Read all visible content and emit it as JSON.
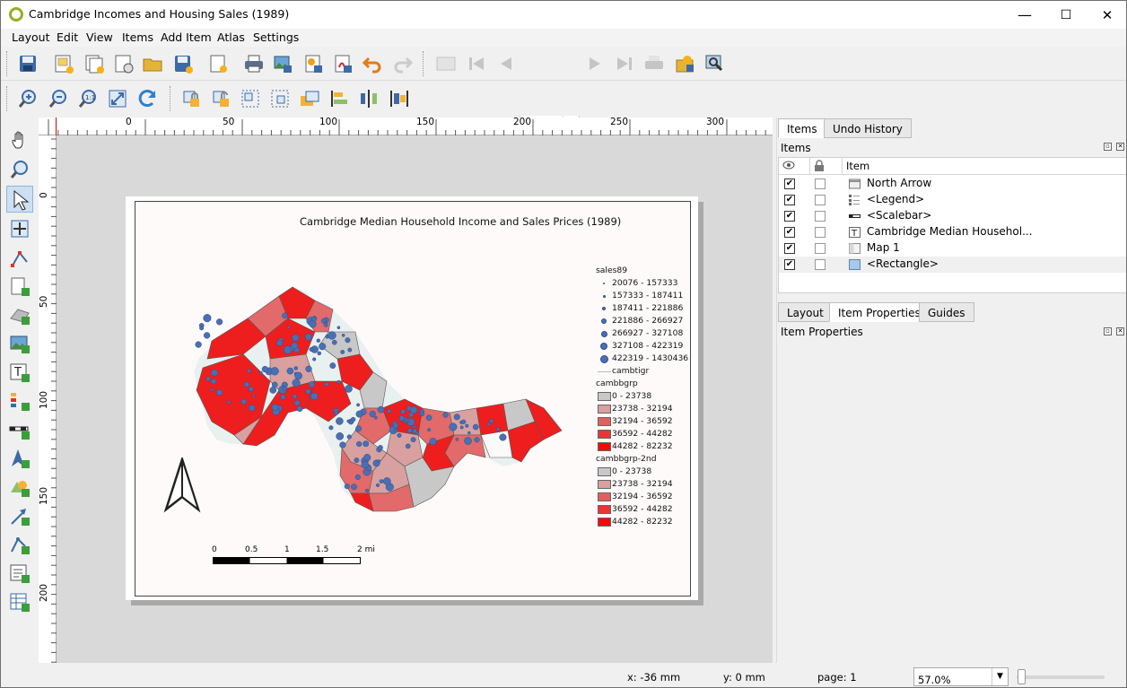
{
  "window": {
    "title": "Cambridge Incomes and Housing Sales (1989)",
    "controls": {
      "minimize": "—",
      "maximize": "☐",
      "close": "✕"
    }
  },
  "menu": [
    "Layout",
    "Edit",
    "View",
    "Items",
    "Add Item",
    "Atlas",
    "Settings"
  ],
  "toolbar": {
    "page_number": "1"
  },
  "ruler": {
    "top": [
      "0",
      "50",
      "100",
      "150",
      "200",
      "250",
      "300"
    ],
    "left": [
      "0",
      "50",
      "100",
      "150",
      "200"
    ]
  },
  "layout": {
    "map_title": "Cambridge Median Household Income and Sales Prices (1989)",
    "legend": {
      "groups": [
        {
          "title": "sales89",
          "kind": "points",
          "items": [
            "20076 - 157333",
            "157333 - 187411",
            "187411 - 221886",
            "221886 - 266927",
            "266927 - 327108",
            "327108 - 422319",
            "422319 - 1430436"
          ]
        },
        {
          "title": "",
          "kind": "line",
          "items": [
            "cambtigr"
          ]
        },
        {
          "title": "cambbgrp",
          "kind": "fill",
          "items": [
            "0 - 23738",
            "23738 - 32194",
            "32194 - 36592",
            "36592 - 44282",
            "44282 - 82232"
          ]
        },
        {
          "title": "cambbgrp-2nd",
          "kind": "fill",
          "items": [
            "0 - 23738",
            "23738 - 32194",
            "32194 - 36592",
            "36592 - 44282",
            "44282 - 82232"
          ]
        }
      ],
      "fill_colors": [
        "#c8c8c8",
        "#d9a0a0",
        "#e06060",
        "#ea3535",
        "#f50a0a"
      ],
      "point_color": "#4a6fb3"
    },
    "scalebar": {
      "labels": [
        "0",
        "0.5",
        "1",
        "1.5",
        "2 mi"
      ]
    }
  },
  "right_panel": {
    "top_tabs": [
      "Items",
      "Undo History"
    ],
    "items_header": "Items",
    "columns": [
      "Item"
    ],
    "items": [
      {
        "label": "North Arrow",
        "visible": true,
        "locked": false,
        "icon": "picture-icon"
      },
      {
        "label": "<Legend>",
        "visible": true,
        "locked": false,
        "icon": "legend-icon"
      },
      {
        "label": "<Scalebar>",
        "visible": true,
        "locked": false,
        "icon": "scalebar-icon"
      },
      {
        "label": "Cambridge Median Househol...",
        "visible": true,
        "locked": false,
        "icon": "label-icon"
      },
      {
        "label": "Map 1",
        "visible": true,
        "locked": false,
        "icon": "map-icon"
      },
      {
        "label": "<Rectangle>",
        "visible": true,
        "locked": false,
        "icon": "rectangle-icon"
      }
    ],
    "bottom_tabs": [
      "Layout",
      "Item Properties",
      "Guides"
    ],
    "properties_header": "Item Properties"
  },
  "status": {
    "x": "x: -36 mm",
    "y": "y: 0 mm",
    "page": "page: 1",
    "zoom": "57.0%"
  }
}
